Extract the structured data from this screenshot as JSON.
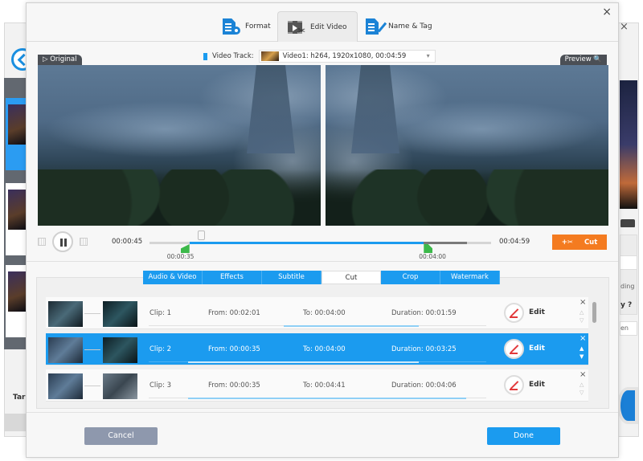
{
  "background_window": {
    "bottom_text": "Tar",
    "right_text_1": "ding",
    "right_text_2": "y ?",
    "right_button": "en"
  },
  "dialog": {
    "close_icon": "×",
    "top_tabs": [
      {
        "label": "Format",
        "icon": "format-icon",
        "active": false
      },
      {
        "label": "Edit Video",
        "icon": "edit-video-icon",
        "active": true
      },
      {
        "label": "Name & Tag",
        "icon": "name-tag-icon",
        "active": false
      }
    ],
    "video_track": {
      "label": "Video Track:",
      "value": "Video1: h264, 1920x1080, 00:04:59",
      "caret": "▾"
    },
    "preview": {
      "original_label": "▷ Original",
      "preview_label": "Preview 🔍"
    },
    "playback": {
      "current_time": "00:00:45",
      "total_time": "00:04:59",
      "start_marker": "00:00:35",
      "end_marker": "00:04:00",
      "playhead_fraction": 0.15,
      "selection_start_fraction": 0.117,
      "selection_end_fraction": 0.803,
      "dark_end_fraction": 0.93,
      "cut_button": {
        "icon": "+✂",
        "label": "Cut"
      }
    },
    "edit_tabs": [
      {
        "label": "Audio & Video",
        "active": false
      },
      {
        "label": "Effects",
        "active": false
      },
      {
        "label": "Subtitle",
        "active": false
      },
      {
        "label": "Cut",
        "active": true
      },
      {
        "label": "Crop",
        "active": false
      },
      {
        "label": "Watermark",
        "active": false
      }
    ],
    "clips": [
      {
        "clip": "Clip: 1",
        "from": "From:  00:02:01",
        "to": "To:  00:04:00",
        "duration": "Duration:  00:01:59",
        "edit": "Edit",
        "selected": false,
        "range": [
          0.4,
          0.8
        ]
      },
      {
        "clip": "Clip: 2",
        "from": "From:  00:00:35",
        "to": "To:  00:04:00",
        "duration": "Duration:  00:03:25",
        "edit": "Edit",
        "selected": true,
        "range": [
          0.117,
          0.8
        ]
      },
      {
        "clip": "Clip: 3",
        "from": "From:  00:00:35",
        "to": "To:  00:04:41",
        "duration": "Duration:  00:04:06",
        "edit": "Edit",
        "selected": false,
        "range": [
          0.117,
          0.94
        ]
      }
    ],
    "row_controls": {
      "delete": "×",
      "up": "△",
      "down": "▽"
    },
    "footer": {
      "cancel": "Cancel",
      "done": "Done"
    }
  }
}
